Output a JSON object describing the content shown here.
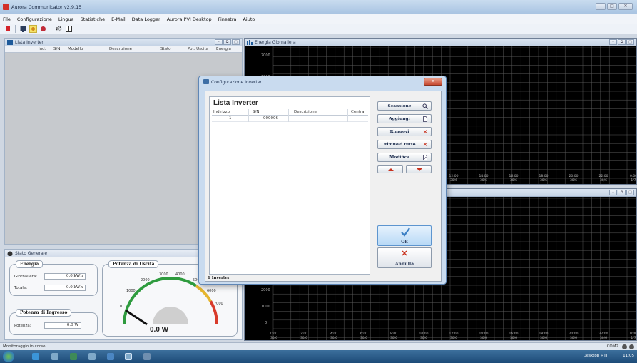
{
  "window": {
    "title": "Aurora Communicator v2.9.15"
  },
  "menu": [
    "File",
    "Configurazione",
    "Lingua",
    "Statistiche",
    "E-Mail",
    "Data Logger",
    "Aurora PVI Desktop",
    "Finestra",
    "Aiuto"
  ],
  "lista_panel": {
    "title": "Lista Inverter",
    "columns": [
      "Ind.",
      "S/N",
      "Modello",
      "Descrizione",
      "Stato",
      "Pot. Uscita",
      "Energia"
    ]
  },
  "energy_panel": {
    "title": "Energia Giornaliera",
    "y_ticks": [
      "7000",
      "6000"
    ],
    "x_ticks": [
      "12:00",
      "14:00",
      "16:00",
      "18:00",
      "20:00",
      "22:00",
      "0:00"
    ],
    "x_subticks": [
      "30/6",
      "30/6",
      "30/6",
      "30/6",
      "30/6",
      "30/6",
      "1/7"
    ]
  },
  "bottom_panel": {
    "y_ticks": [
      "2000",
      "1000",
      "0"
    ],
    "x_ticks": [
      "0:00",
      "2:00",
      "4:00",
      "6:00",
      "8:00",
      "10:00",
      "12:00",
      "14:00",
      "16:00",
      "18:00",
      "20:00",
      "22:00",
      "0:00"
    ],
    "x_subticks": [
      "30/6",
      "30/6",
      "30/6",
      "30/6",
      "30/6",
      "30/6",
      "30/6",
      "30/6",
      "30/6",
      "30/6",
      "30/6",
      "30/6",
      "1/7"
    ]
  },
  "stato_panel": {
    "title": "Stato Generale",
    "energia": {
      "title": "Energia",
      "giornaliera_label": "Giornaliera:",
      "giornaliera_value": "0.0 kWh",
      "totale_label": "Totale:",
      "totale_value": "0.0 kWh"
    },
    "potenza_ingresso": {
      "title": "Potenza di Ingresso",
      "label": "Potenza:",
      "value": "0.0 W"
    },
    "potenza_uscita": {
      "title": "Potenza di Uscita",
      "reading": "0.0 W",
      "scale": [
        "0",
        "1000",
        "2000",
        "3000",
        "4000",
        "5000",
        "6000",
        "7000"
      ]
    }
  },
  "dialog": {
    "title": "Configurazione Inverter",
    "list_title": "Lista Inverter",
    "columns": [
      "Indirizzo",
      "S/N",
      "Descrizione",
      "Central"
    ],
    "rows": [
      {
        "indirizzo": "1",
        "sn": "000006",
        "descrizione": "",
        "central": ""
      }
    ],
    "buttons": {
      "scansione": "Scansione",
      "aggiungi": "Aggiungi",
      "rimuovi": "Rimuovi",
      "rimuovi_tutto": "Rimuovi tutto",
      "modifica": "Modifica",
      "ok": "Ok",
      "annulla": "Annulla"
    },
    "footer": "1 Inverter"
  },
  "statusbar": {
    "text": "Monitoraggio in corso...",
    "port": "COM2"
  },
  "taskbar": {
    "desktop_label": "Desktop",
    "lang": "IT",
    "time": "11:05"
  },
  "colors": {
    "accent": "#3d6ea5",
    "chart_grid": "#5a5a5a",
    "close_red": "#c74a32"
  }
}
